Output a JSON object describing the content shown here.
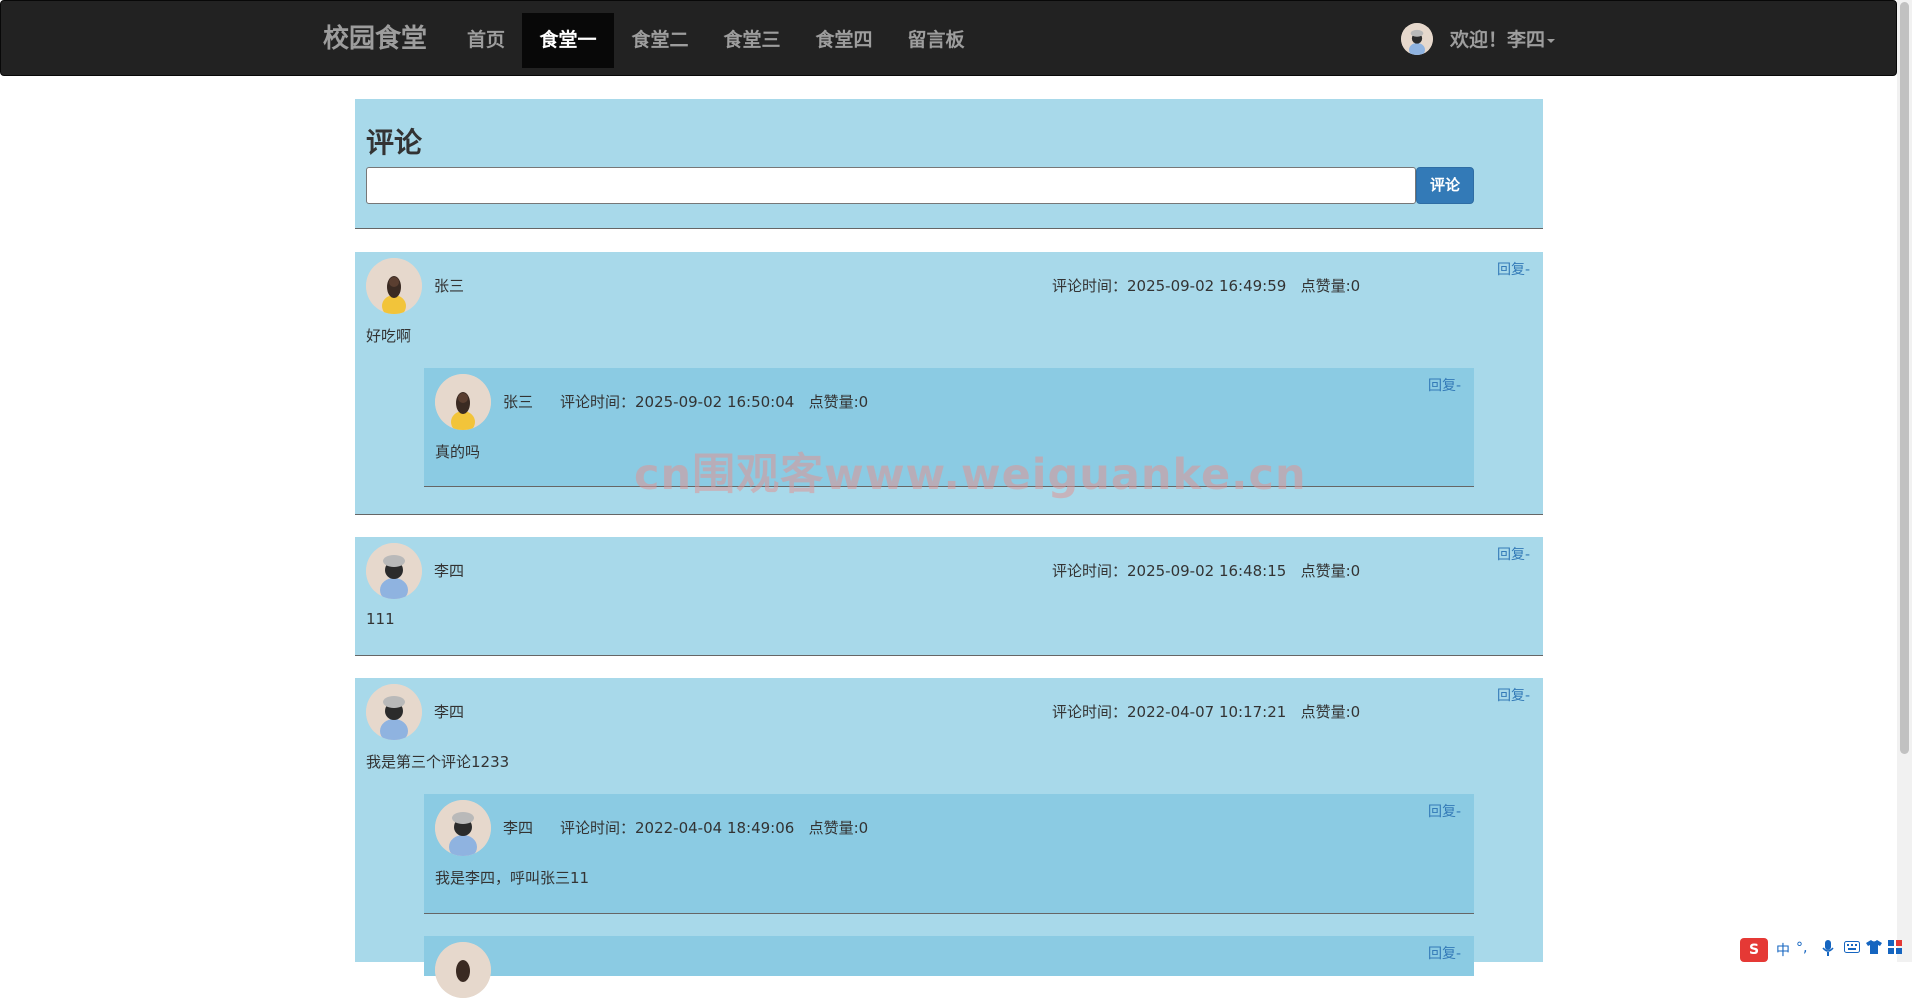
{
  "navbar": {
    "brand": "校园食堂",
    "items": [
      {
        "label": "首页",
        "active": false
      },
      {
        "label": "食堂一",
        "active": true
      },
      {
        "label": "食堂二",
        "active": false
      },
      {
        "label": "食堂三",
        "active": false
      },
      {
        "label": "食堂四",
        "active": false
      },
      {
        "label": "留言板",
        "active": false
      }
    ],
    "welcome": "欢迎！李四"
  },
  "form": {
    "title": "评论",
    "input_value": "",
    "submit_label": "评论"
  },
  "comments": [
    {
      "author": "张三",
      "avatar": "avatar-yellow",
      "meta": "评论时间：2025-09-02 16:49:59   点赞量:0",
      "content": "好吃啊",
      "reply_label": "回复-",
      "replies": [
        {
          "author": "张三",
          "avatar": "avatar-yellow",
          "meta": "评论时间：2025-09-02 16:50:04   点赞量:0",
          "content": "真的吗",
          "reply_label": "回复-"
        }
      ]
    },
    {
      "author": "李四",
      "avatar": "avatar-blue",
      "meta": "评论时间：2025-09-02 16:48:15   点赞量:0",
      "content": "111",
      "reply_label": "回复-",
      "replies": []
    },
    {
      "author": "李四",
      "avatar": "avatar-blue",
      "meta": "评论时间：2022-04-07 10:17:21   点赞量:0",
      "content": "我是第三个评论1233",
      "reply_label": "回复-",
      "replies": [
        {
          "author": "李四",
          "avatar": "avatar-blue",
          "meta": "评论时间：2022-04-04 18:49:06   点赞量:0",
          "content": "我是李四，呼叫张三11",
          "reply_label": "回复-"
        },
        {
          "author": "",
          "avatar": "avatar-yellow",
          "meta": "",
          "content": "",
          "reply_label": "回复-"
        }
      ]
    }
  ],
  "watermark": "cn围观客www.weiguanke.cn",
  "ime": {
    "logo": "S",
    "lang": "中",
    "punct": "°,"
  },
  "colors": {
    "navbar_bg": "#222222",
    "panel_bg": "#a8d9ea",
    "reply_bg": "#8bcbe3",
    "button_primary": "#337ab7",
    "link": "#337ab7"
  }
}
